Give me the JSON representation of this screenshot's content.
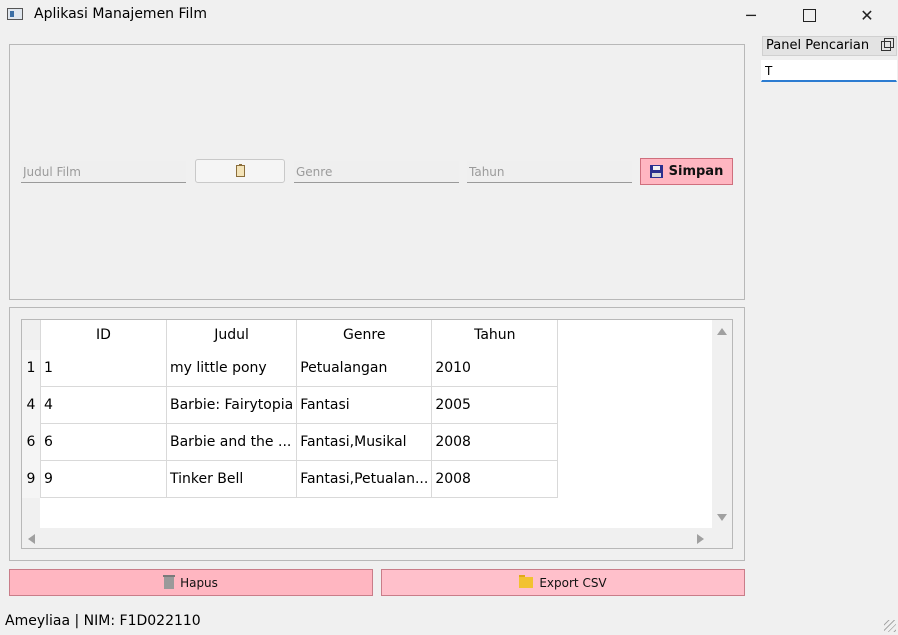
{
  "window": {
    "title": "Aplikasi Manajemen Film",
    "minimize": "─",
    "close": "✕"
  },
  "form": {
    "judul_placeholder": "Judul Film",
    "judul_value": "",
    "genre_placeholder": "Genre",
    "genre_value": "",
    "tahun_placeholder": "Tahun",
    "tahun_value": "",
    "save_label": "Simpan"
  },
  "table": {
    "columns": [
      "ID",
      "Judul",
      "Genre",
      "Tahun"
    ],
    "rows": [
      {
        "row_header": "1",
        "id": "1",
        "judul": "my little pony",
        "genre": "Petualangan",
        "tahun": "2010"
      },
      {
        "row_header": "4",
        "id": "4",
        "judul": "Barbie: Fairytopia",
        "genre": "Fantasi",
        "tahun": "2005"
      },
      {
        "row_header": "6",
        "id": "6",
        "judul": "Barbie and the ...",
        "genre": "Fantasi,Musikal",
        "tahun": "2008"
      },
      {
        "row_header": "9",
        "id": "9",
        "judul": "Tinker Bell",
        "genre": "Fantasi,Petualan...",
        "tahun": "2008"
      }
    ]
  },
  "actions": {
    "delete_label": "Hapus",
    "export_label": "Export CSV"
  },
  "search_panel": {
    "title": "Panel Pencarian",
    "value": "T"
  },
  "status_bar": "Ameyliaa | NIM: F1D022110",
  "colors": {
    "button_pink": "#ffb6c1",
    "focus_blue": "#2c7cd1"
  },
  "icons": [
    "app-icon",
    "minimize-icon",
    "maximize-icon",
    "close-icon",
    "clipboard-icon",
    "floppy-icon",
    "trash-icon",
    "folder-icon",
    "float-icon"
  ]
}
